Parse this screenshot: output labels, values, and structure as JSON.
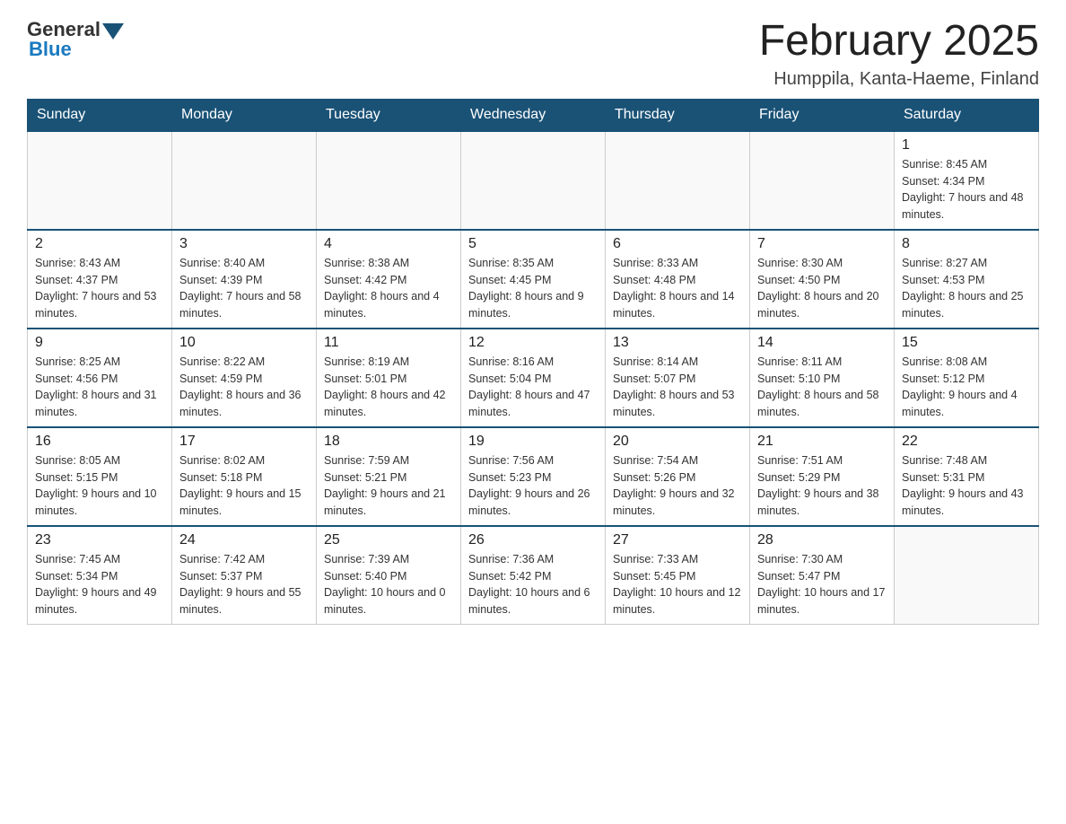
{
  "header": {
    "logo_text": "General",
    "logo_blue": "Blue",
    "title": "February 2025",
    "location": "Humppila, Kanta-Haeme, Finland"
  },
  "days_of_week": [
    "Sunday",
    "Monday",
    "Tuesday",
    "Wednesday",
    "Thursday",
    "Friday",
    "Saturday"
  ],
  "weeks": [
    [
      {
        "day": "",
        "info": ""
      },
      {
        "day": "",
        "info": ""
      },
      {
        "day": "",
        "info": ""
      },
      {
        "day": "",
        "info": ""
      },
      {
        "day": "",
        "info": ""
      },
      {
        "day": "",
        "info": ""
      },
      {
        "day": "1",
        "info": "Sunrise: 8:45 AM\nSunset: 4:34 PM\nDaylight: 7 hours and 48 minutes."
      }
    ],
    [
      {
        "day": "2",
        "info": "Sunrise: 8:43 AM\nSunset: 4:37 PM\nDaylight: 7 hours and 53 minutes."
      },
      {
        "day": "3",
        "info": "Sunrise: 8:40 AM\nSunset: 4:39 PM\nDaylight: 7 hours and 58 minutes."
      },
      {
        "day": "4",
        "info": "Sunrise: 8:38 AM\nSunset: 4:42 PM\nDaylight: 8 hours and 4 minutes."
      },
      {
        "day": "5",
        "info": "Sunrise: 8:35 AM\nSunset: 4:45 PM\nDaylight: 8 hours and 9 minutes."
      },
      {
        "day": "6",
        "info": "Sunrise: 8:33 AM\nSunset: 4:48 PM\nDaylight: 8 hours and 14 minutes."
      },
      {
        "day": "7",
        "info": "Sunrise: 8:30 AM\nSunset: 4:50 PM\nDaylight: 8 hours and 20 minutes."
      },
      {
        "day": "8",
        "info": "Sunrise: 8:27 AM\nSunset: 4:53 PM\nDaylight: 8 hours and 25 minutes."
      }
    ],
    [
      {
        "day": "9",
        "info": "Sunrise: 8:25 AM\nSunset: 4:56 PM\nDaylight: 8 hours and 31 minutes."
      },
      {
        "day": "10",
        "info": "Sunrise: 8:22 AM\nSunset: 4:59 PM\nDaylight: 8 hours and 36 minutes."
      },
      {
        "day": "11",
        "info": "Sunrise: 8:19 AM\nSunset: 5:01 PM\nDaylight: 8 hours and 42 minutes."
      },
      {
        "day": "12",
        "info": "Sunrise: 8:16 AM\nSunset: 5:04 PM\nDaylight: 8 hours and 47 minutes."
      },
      {
        "day": "13",
        "info": "Sunrise: 8:14 AM\nSunset: 5:07 PM\nDaylight: 8 hours and 53 minutes."
      },
      {
        "day": "14",
        "info": "Sunrise: 8:11 AM\nSunset: 5:10 PM\nDaylight: 8 hours and 58 minutes."
      },
      {
        "day": "15",
        "info": "Sunrise: 8:08 AM\nSunset: 5:12 PM\nDaylight: 9 hours and 4 minutes."
      }
    ],
    [
      {
        "day": "16",
        "info": "Sunrise: 8:05 AM\nSunset: 5:15 PM\nDaylight: 9 hours and 10 minutes."
      },
      {
        "day": "17",
        "info": "Sunrise: 8:02 AM\nSunset: 5:18 PM\nDaylight: 9 hours and 15 minutes."
      },
      {
        "day": "18",
        "info": "Sunrise: 7:59 AM\nSunset: 5:21 PM\nDaylight: 9 hours and 21 minutes."
      },
      {
        "day": "19",
        "info": "Sunrise: 7:56 AM\nSunset: 5:23 PM\nDaylight: 9 hours and 26 minutes."
      },
      {
        "day": "20",
        "info": "Sunrise: 7:54 AM\nSunset: 5:26 PM\nDaylight: 9 hours and 32 minutes."
      },
      {
        "day": "21",
        "info": "Sunrise: 7:51 AM\nSunset: 5:29 PM\nDaylight: 9 hours and 38 minutes."
      },
      {
        "day": "22",
        "info": "Sunrise: 7:48 AM\nSunset: 5:31 PM\nDaylight: 9 hours and 43 minutes."
      }
    ],
    [
      {
        "day": "23",
        "info": "Sunrise: 7:45 AM\nSunset: 5:34 PM\nDaylight: 9 hours and 49 minutes."
      },
      {
        "day": "24",
        "info": "Sunrise: 7:42 AM\nSunset: 5:37 PM\nDaylight: 9 hours and 55 minutes."
      },
      {
        "day": "25",
        "info": "Sunrise: 7:39 AM\nSunset: 5:40 PM\nDaylight: 10 hours and 0 minutes."
      },
      {
        "day": "26",
        "info": "Sunrise: 7:36 AM\nSunset: 5:42 PM\nDaylight: 10 hours and 6 minutes."
      },
      {
        "day": "27",
        "info": "Sunrise: 7:33 AM\nSunset: 5:45 PM\nDaylight: 10 hours and 12 minutes."
      },
      {
        "day": "28",
        "info": "Sunrise: 7:30 AM\nSunset: 5:47 PM\nDaylight: 10 hours and 17 minutes."
      },
      {
        "day": "",
        "info": ""
      }
    ]
  ]
}
